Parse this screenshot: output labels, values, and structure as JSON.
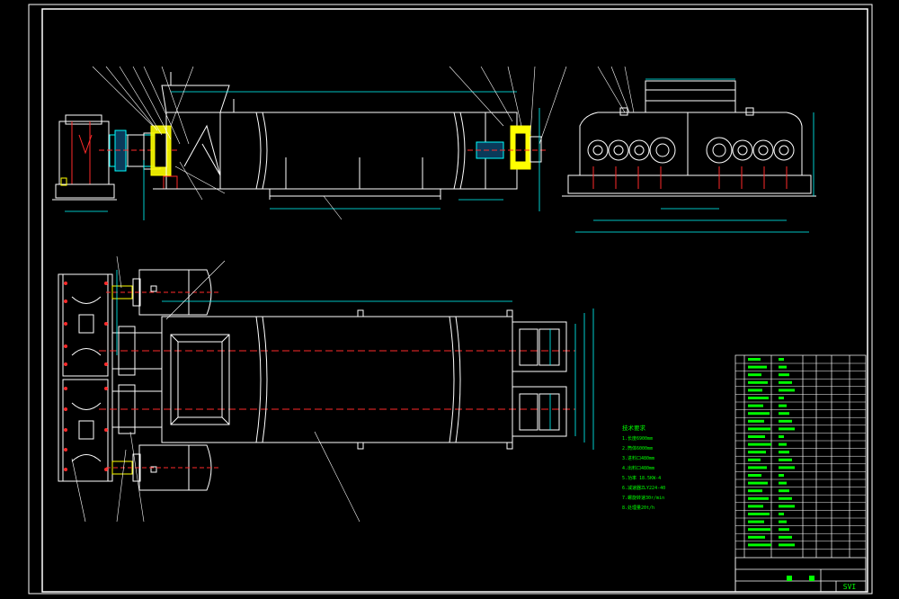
{
  "colors": {
    "background": "#000000",
    "outline": "#ffffff",
    "dimension": "#00ffff",
    "section": "#ff2a2a",
    "parts": "#ffff00",
    "notes": "#00ff00",
    "motor": "#00ffff"
  },
  "drawing": {
    "title_block_label": "SVI",
    "technical_notes": [
      "技术要求",
      "1.长度6900mm",
      "2.筒体6000mm",
      "3.进料口480mm",
      "4.出料口480mm",
      "5.功率 18.5KW-4",
      "6.减速器ZLY224-40",
      "7.螺旋转速30r/min",
      "8.处理量20t/h"
    ]
  }
}
